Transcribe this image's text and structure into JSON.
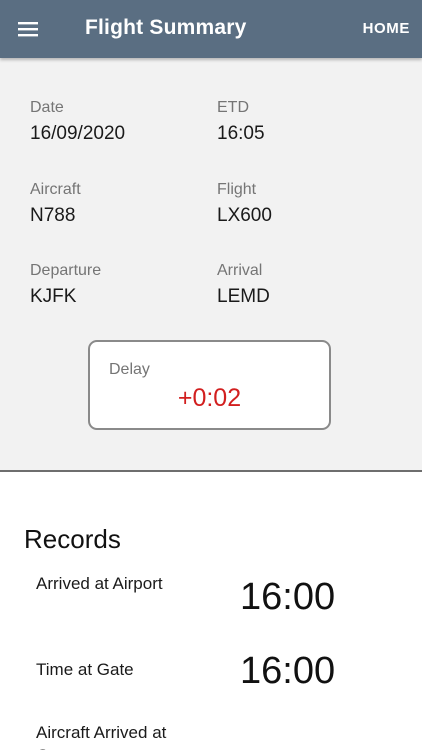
{
  "header": {
    "title": "Flight Summary",
    "home_label": "HOME",
    "menu_icon": "hamburger-menu-icon",
    "background_color": "#5a6e82"
  },
  "summary": {
    "date": {
      "label": "Date",
      "value": "16/09/2020"
    },
    "etd": {
      "label": "ETD",
      "value": "16:05"
    },
    "aircraft": {
      "label": "Aircraft",
      "value": "N788"
    },
    "flight": {
      "label": "Flight",
      "value": "LX600"
    },
    "departure": {
      "label": "Departure",
      "value": "KJFK"
    },
    "arrival": {
      "label": "Arrival",
      "value": "LEMD"
    },
    "delay": {
      "label": "Delay",
      "value": "+0:02",
      "color": "#d21f1f"
    }
  },
  "records": {
    "title": "Records",
    "items": [
      {
        "label": "Arrived at Airport",
        "time": "16:00"
      },
      {
        "label": "Time at Gate",
        "time": "16:00"
      },
      {
        "label": "Aircraft Arrived at Gate",
        "time": ""
      }
    ]
  }
}
